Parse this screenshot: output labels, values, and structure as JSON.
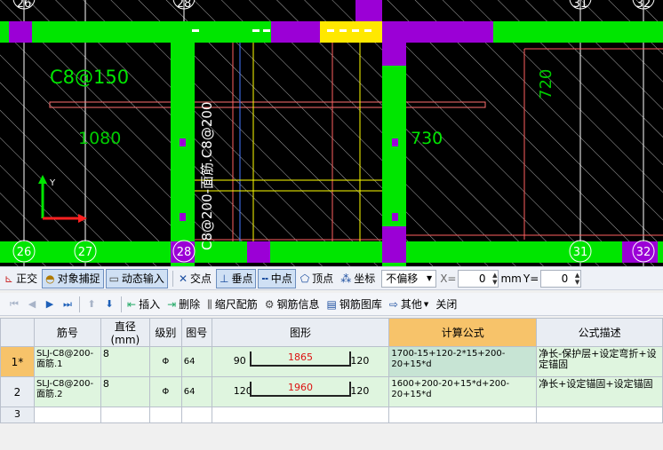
{
  "cad": {
    "axis_top": [
      "26",
      "28",
      "31",
      "32"
    ],
    "axis_bottom": [
      "26",
      "27",
      "28",
      "31",
      "32"
    ],
    "labels": {
      "c8_150": "C8@150",
      "d1080": "1080",
      "d730": "730",
      "d720": "720",
      "vertical_rebar": "C8@200-面筋.C8@200"
    },
    "axis_y": "Y",
    "colors": {
      "beam": "#00e600",
      "column": "#9b00d6",
      "highlight": "#ffe800",
      "grid": "#ffffff"
    }
  },
  "snapbar": {
    "orthogonal": "正交",
    "object_snap": "对象捕捉",
    "dynamic_input": "动态输入",
    "intersection": "交点",
    "perpendicular": "垂点",
    "midpoint": "中点",
    "vertex": "顶点",
    "coordinate": "坐标",
    "offset_value": "不偏移",
    "x_label": "X=",
    "x_value": "0",
    "unit": "mm",
    "y_label": "Y=",
    "y_value": "0"
  },
  "rebarbar": {
    "insert": "插入",
    "delete": "删除",
    "scale_rebar": "缩尺配筋",
    "rebar_info": "钢筋信息",
    "rebar_library": "钢筋图库",
    "other": "其他",
    "close": "关闭"
  },
  "table": {
    "headers": [
      "筋号",
      "直径(mm)",
      "级别",
      "图号",
      "图形",
      "计算公式",
      "公式描述"
    ],
    "rows": [
      {
        "index": "1*",
        "name": "SLJ-C8@200-面筋.1",
        "diameter": "8",
        "grade": "Φ",
        "fig": "64",
        "left": "90",
        "middle": "1865",
        "right": "120",
        "formula": "1700-15+120-2*15+200-20+15*d",
        "description": "净长-保护层+设定弯折+设定锚固"
      },
      {
        "index": "2",
        "name": "SLJ-C8@200-面筋.2",
        "diameter": "8",
        "grade": "Φ",
        "fig": "64",
        "left": "120",
        "middle": "1960",
        "right": "120",
        "formula": "1600+200-20+15*d+200-20+15*d",
        "description": "净长+设定锚固+设定锚固"
      }
    ],
    "blank_index": "3"
  }
}
